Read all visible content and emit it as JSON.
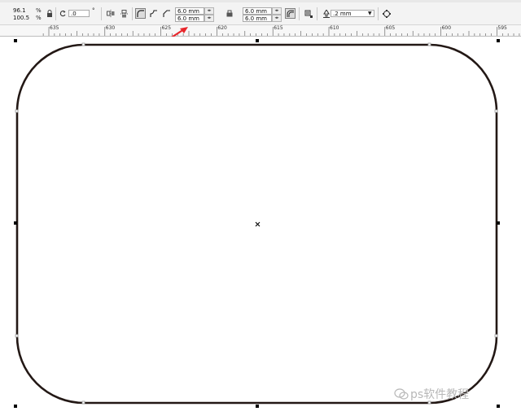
{
  "toolbar": {
    "scale_x": "96.1",
    "scale_y": "100.5",
    "percent_symbol": "%",
    "rotation": ".0",
    "degree_symbol": "°",
    "corner_radius_top_left": "6.0 mm",
    "corner_radius_bottom_left": "6.0 mm",
    "corner_radius_top_right": "6.0 mm",
    "corner_radius_bottom_right": "6.0 mm",
    "outline_width": ".2 mm"
  },
  "ruler": {
    "ticks": [
      "635",
      "630",
      "625",
      "620",
      "615",
      "610",
      "605",
      "600",
      "595"
    ]
  },
  "watermark": {
    "text": "ps软件教程"
  },
  "colors": {
    "shape_outline": "#231815",
    "annotation_arrow": "#e8262b"
  }
}
